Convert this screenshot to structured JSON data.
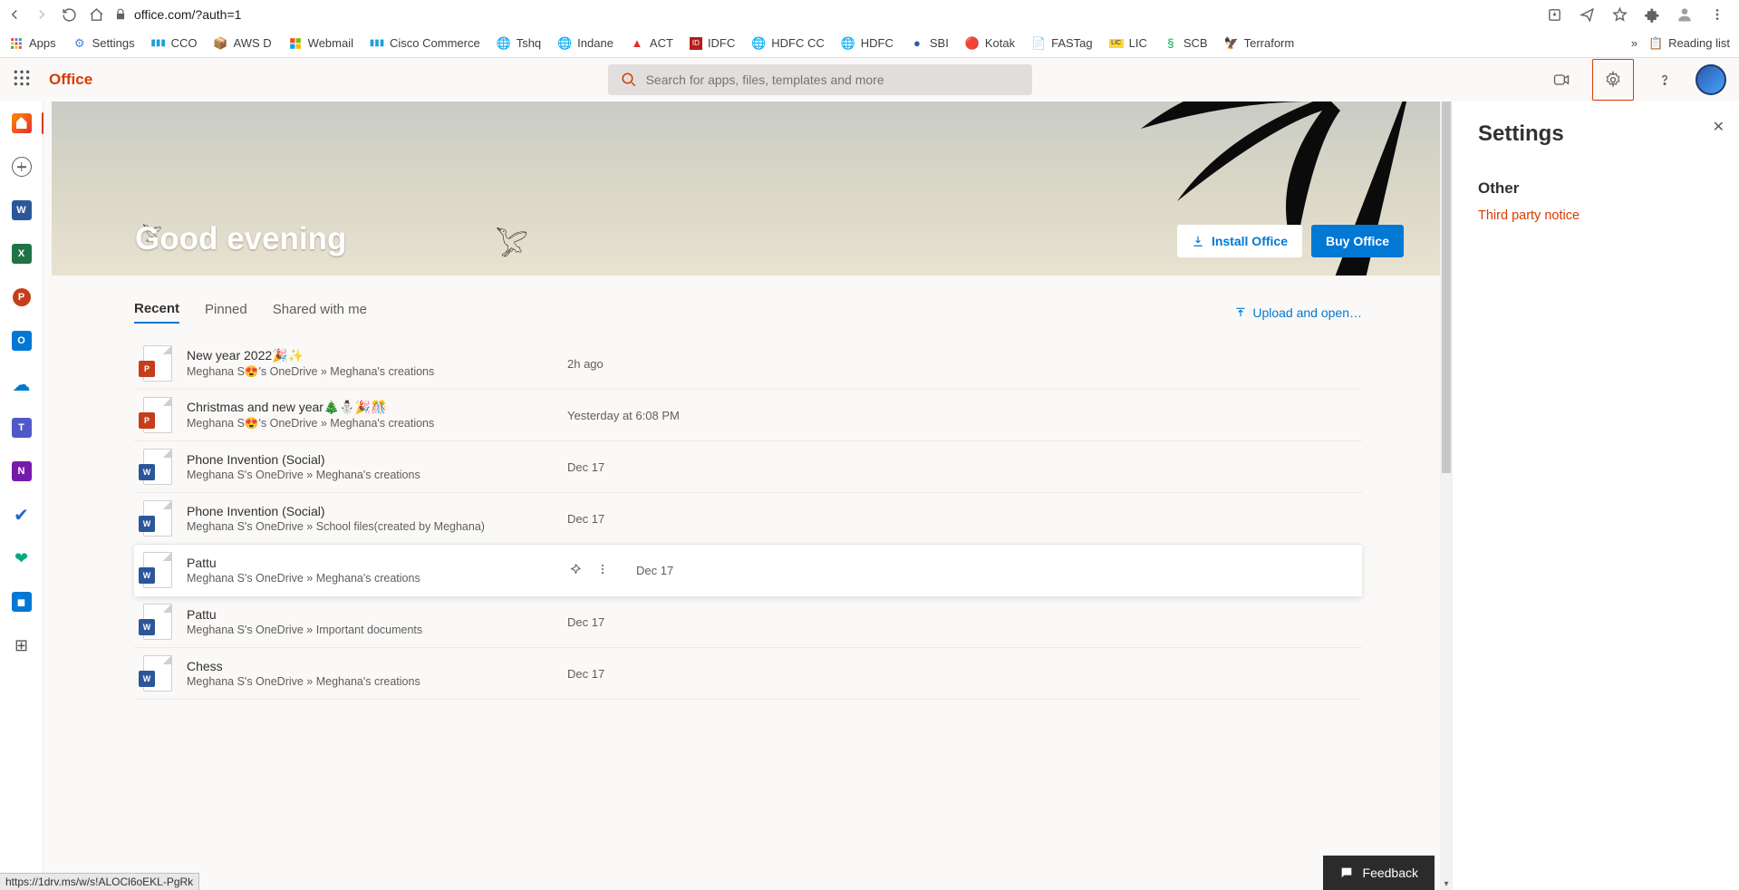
{
  "browser": {
    "url": "office.com/?auth=1",
    "bookmarks": [
      "Apps",
      "Settings",
      "CCO",
      "AWS D",
      "Webmail",
      "Cisco Commerce",
      "Tshq",
      "Indane",
      "ACT",
      "IDFC",
      "HDFC CC",
      "HDFC",
      "SBI",
      "Kotak",
      "FASTag",
      "LIC",
      "SCB",
      "Terraform"
    ],
    "reading_list": "Reading list",
    "status_url": "https://1drv.ms/w/s!ALOCl6oEKL-PgRk"
  },
  "header": {
    "brand": "Office",
    "search_placeholder": "Search for apps, files, templates and more"
  },
  "hero": {
    "greeting": "Good evening",
    "install_label": "Install Office",
    "buy_label": "Buy Office"
  },
  "tabs": {
    "recent": "Recent",
    "pinned": "Pinned",
    "shared": "Shared with me",
    "upload": "Upload and open…"
  },
  "files": [
    {
      "app": "P",
      "appColor": "#c43e1c",
      "title": "New year 2022🎉✨",
      "path": "Meghana S😍's OneDrive » Meghana's creations",
      "date": "2h ago"
    },
    {
      "app": "P",
      "appColor": "#c43e1c",
      "title": "Christmas and new year🎄⛄🎉🎊",
      "path": "Meghana S😍's OneDrive » Meghana's creations",
      "date": "Yesterday at 6:08 PM"
    },
    {
      "app": "W",
      "appColor": "#2b579a",
      "title": "Phone Invention (Social)",
      "path": "Meghana S's OneDrive » Meghana's creations",
      "date": "Dec 17"
    },
    {
      "app": "W",
      "appColor": "#2b579a",
      "title": "Phone Invention (Social)",
      "path": "Meghana S's OneDrive » School files(created by Meghana)",
      "date": "Dec 17"
    },
    {
      "app": "W",
      "appColor": "#2b579a",
      "title": "Pattu",
      "path": "Meghana S's OneDrive » Meghana's creations",
      "date": "Dec 17",
      "hovered": true
    },
    {
      "app": "W",
      "appColor": "#2b579a",
      "title": "Pattu",
      "path": "Meghana S's OneDrive » Important documents",
      "date": "Dec 17"
    },
    {
      "app": "W",
      "appColor": "#2b579a",
      "title": "Chess",
      "path": "Meghana S's OneDrive » Meghana's creations",
      "date": "Dec 17"
    }
  ],
  "settings": {
    "title": "Settings",
    "section": "Other",
    "link": "Third party notice"
  },
  "feedback": {
    "label": "Feedback"
  }
}
